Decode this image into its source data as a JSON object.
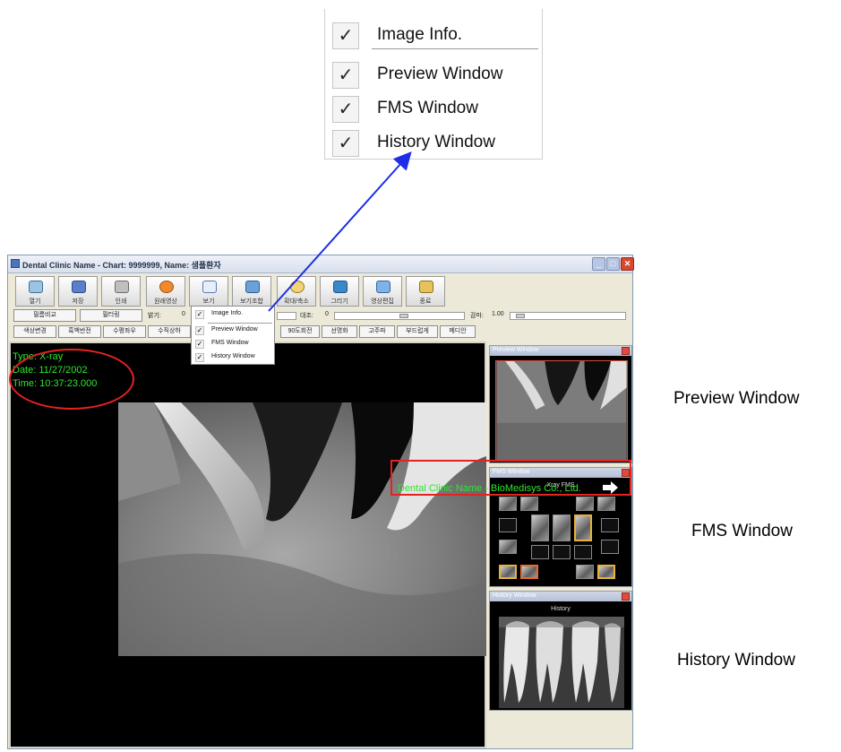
{
  "zoom_menu": {
    "items": [
      {
        "label": "Image Info.",
        "checked": true
      },
      {
        "label": "Preview Window",
        "checked": true
      },
      {
        "label": "FMS Window",
        "checked": true
      },
      {
        "label": "History Window",
        "checked": true
      }
    ],
    "check_glyph": "✓"
  },
  "side_labels": {
    "preview": "Preview Window",
    "fms": "FMS Window",
    "history": "History Window"
  },
  "window": {
    "title": "Dental Clinic Name  -  Chart: 9999999, Name: 샘플환자"
  },
  "toolbar": {
    "buttons": [
      {
        "label": "열기",
        "icon": "open-icon"
      },
      {
        "label": "저장",
        "icon": "save-icon"
      },
      {
        "label": "인쇄",
        "icon": "print-icon"
      },
      {
        "label": "원래영상",
        "icon": "original-image-icon"
      },
      {
        "label": "보기",
        "icon": "view-icon"
      },
      {
        "label": "보기조합",
        "icon": "view-combine-icon"
      },
      {
        "label": "확대/축소",
        "icon": "zoom-icon"
      },
      {
        "label": "그리기",
        "icon": "draw-icon"
      },
      {
        "label": "영상편집",
        "icon": "image-edit-icon"
      },
      {
        "label": "종료",
        "icon": "exit-icon"
      }
    ]
  },
  "controls": {
    "row2_btn1": "필름비교",
    "row2_btn2": "필터링",
    "brightness_label": "밝기:",
    "brightness_value": "0",
    "contrast_label": "대조:",
    "contrast_value": "0",
    "gamma_label": "감마:",
    "gamma_value": "1.00",
    "row3_buttons": [
      "색상변경",
      "흑백반전",
      "수평좌우",
      "수직상하",
      "90도회전",
      "선명화",
      "고주파",
      "부드럽게",
      "메디안"
    ]
  },
  "small_menu": {
    "items": [
      "Image Info.",
      "Preview Window",
      "FMS Window",
      "History Window"
    ]
  },
  "image_info": {
    "type": "Type: X-ray",
    "date": "Date: 11/27/2002",
    "time": "Time: 10:37:23.000"
  },
  "status": {
    "text": "Dental Clinic Name - BioMedisys Co., Ltd."
  },
  "panels": {
    "preview_title": "Preview Window",
    "fms_title": "FMS Window",
    "fms_sub": "Xray FMS",
    "history_title": "History Window",
    "history_sub": "History"
  },
  "colors": {
    "info_text": "#2ee62e",
    "highlight_red": "#e52222",
    "arrow_blue": "#1c2ee6"
  }
}
